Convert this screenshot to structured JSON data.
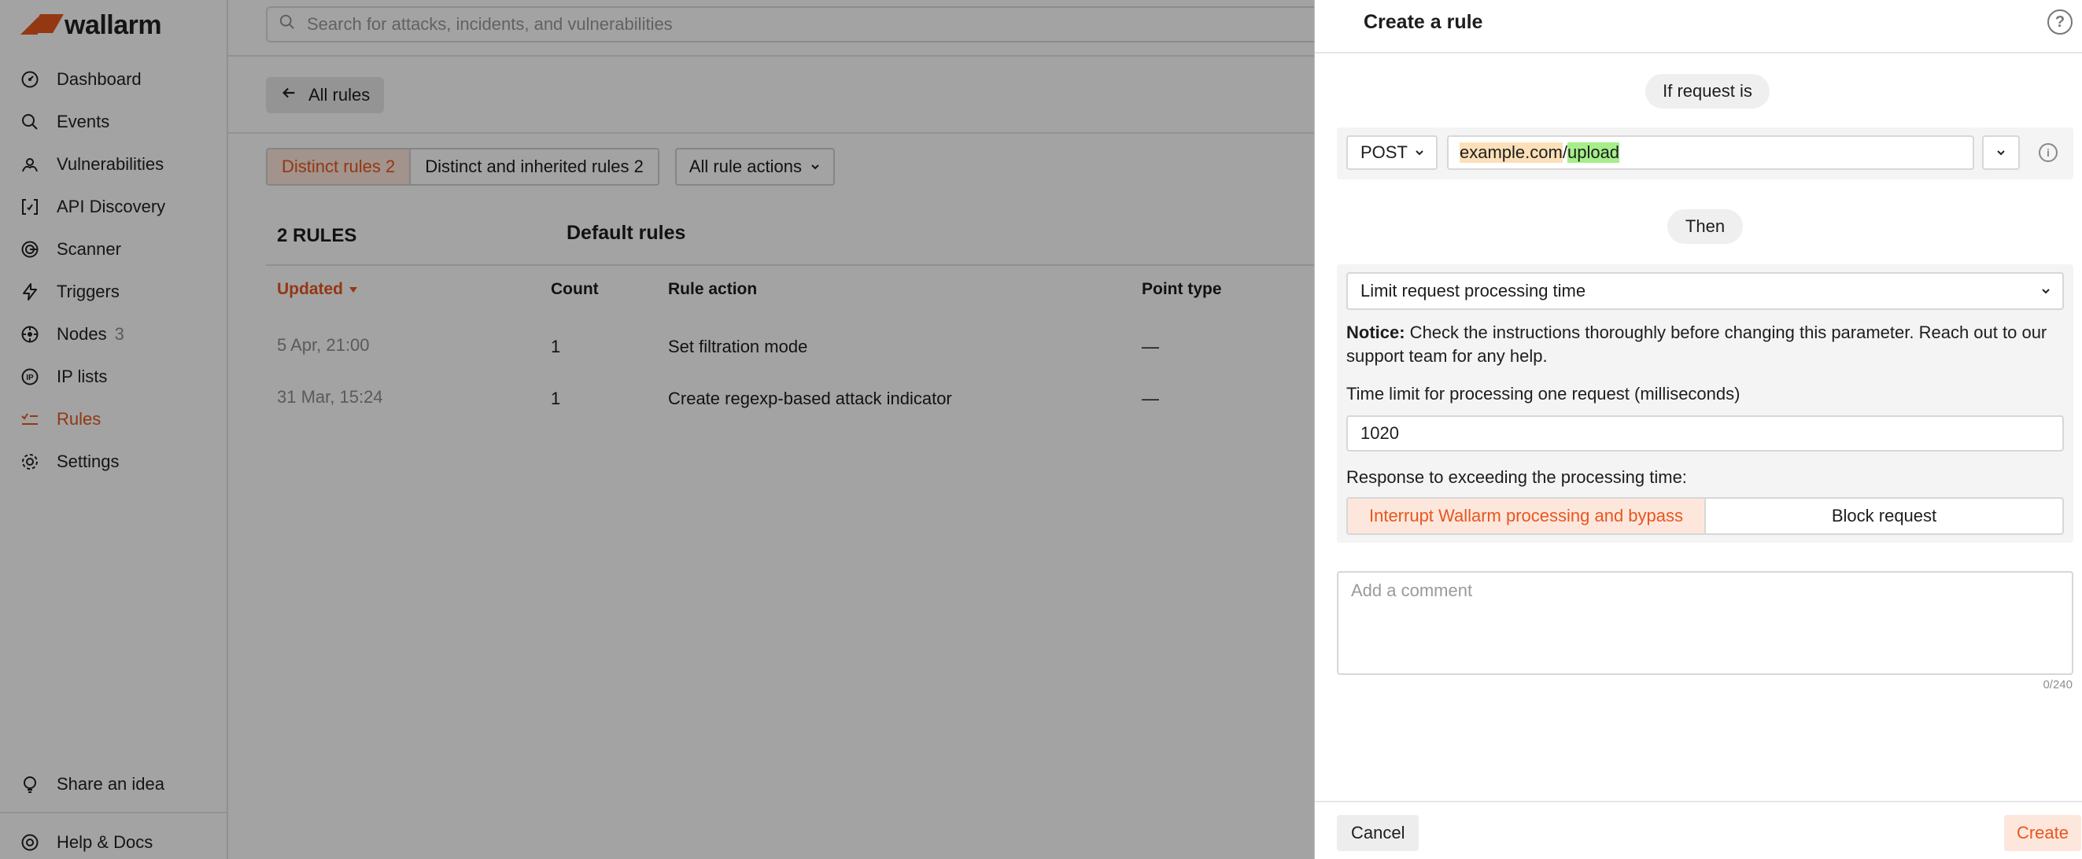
{
  "brand": {
    "name": "wallarm",
    "accent_color": "#e8561f"
  },
  "sidebar": {
    "items": [
      {
        "label": "Dashboard",
        "icon": "dashboard-icon"
      },
      {
        "label": "Events",
        "icon": "search-icon"
      },
      {
        "label": "Vulnerabilities",
        "icon": "bug-icon"
      },
      {
        "label": "API Discovery",
        "icon": "api-discovery-icon"
      },
      {
        "label": "Scanner",
        "icon": "scanner-icon"
      },
      {
        "label": "Triggers",
        "icon": "lightning-icon"
      },
      {
        "label": "Nodes",
        "count": "3",
        "icon": "nodes-icon"
      },
      {
        "label": "IP lists",
        "icon": "ip-lists-icon"
      },
      {
        "label": "Rules",
        "icon": "rules-icon",
        "active": true
      },
      {
        "label": "Settings",
        "icon": "gear-icon"
      }
    ],
    "bottom": [
      {
        "label": "Share an idea",
        "icon": "lightbulb-icon"
      },
      {
        "label": "Help & Docs",
        "icon": "lifebuoy-icon"
      }
    ]
  },
  "search": {
    "placeholder": "Search for attacks, incidents, and vulnerabilities"
  },
  "back_button": {
    "label": "All rules"
  },
  "filters": {
    "distinct": "Distinct rules 2",
    "inherited": "Distinct and inherited rules 2",
    "actions": "All rule actions"
  },
  "rules_header": {
    "count_label": "2 RULES",
    "group_title": "Default rules"
  },
  "table": {
    "columns": [
      "Updated",
      "Count",
      "Rule action",
      "Point type"
    ],
    "rows": [
      {
        "updated": "5 Apr, 21:00",
        "count": "1",
        "action": "Set filtration mode",
        "point_type": "—"
      },
      {
        "updated": "31 Mar, 15:24",
        "count": "1",
        "action": "Create regexp-based attack indicator",
        "point_type": "—"
      }
    ]
  },
  "drawer": {
    "title": "Create a rule",
    "condition_pill": "If request is",
    "method": "POST",
    "url_domain": "example.com",
    "url_sep": "/",
    "url_path": "upload",
    "then_pill": "Then",
    "action_select": "Limit request processing time",
    "notice_label": "Notice:",
    "notice_text": " Check the instructions thoroughly before changing this parameter. Reach out to our support team for any help.",
    "time_limit_label": "Time limit for processing one request (milliseconds)",
    "time_limit_value": "1020",
    "response_label": "Response to exceeding the processing time:",
    "response_options": [
      "Interrupt Wallarm processing and bypass",
      "Block request"
    ],
    "comment_placeholder": "Add a comment",
    "comment_counter": "0/240",
    "cancel": "Cancel",
    "create": "Create"
  }
}
